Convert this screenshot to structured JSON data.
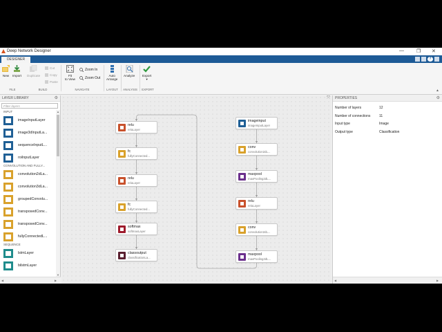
{
  "window": {
    "title": "Deep Network Designer",
    "minimize": "—",
    "maximize": "❐",
    "close": "✕"
  },
  "tabs": [
    {
      "label": "DESIGNER"
    }
  ],
  "toolstrip": {
    "file": {
      "new": "New",
      "import": "Import",
      "section": "FILE"
    },
    "build": {
      "duplicate": "Duplicate",
      "cut": "Cut",
      "copy": "Copy",
      "paste": "Paste",
      "section": "BUILD"
    },
    "navigate": {
      "fit_line1": "Fit",
      "fit_line2": "to View",
      "zoom_in": "Zoom In",
      "zoom_out": "Zoom Out",
      "section": "NAVIGATE"
    },
    "layout": {
      "auto_line1": "Auto",
      "auto_line2": "Arrange",
      "section": "LAYOUT"
    },
    "analysis": {
      "analyze": "Analyze",
      "section": "ANALYSIS"
    },
    "export": {
      "export": "Export",
      "section": "EXPORT"
    }
  },
  "library": {
    "title": "LAYER LIBRARY",
    "filter_placeholder": "Filter layers",
    "categories": [
      {
        "name": "INPUT",
        "items": [
          {
            "label": "imageInputLayer",
            "icon": "image-input-icon"
          },
          {
            "label": "image3dInputLa...",
            "icon": "image3d-input-icon"
          },
          {
            "label": "sequenceInputL...",
            "icon": "sequence-input-icon"
          },
          {
            "label": "roiInputLayer",
            "icon": "roi-input-icon"
          }
        ]
      },
      {
        "name": "CONVOLUTION AND FULLY...",
        "items": [
          {
            "label": "convolution2dLa...",
            "icon": "conv2d-icon"
          },
          {
            "label": "convolution3dLa...",
            "icon": "conv3d-icon"
          },
          {
            "label": "groupedConvolu...",
            "icon": "grouped-conv-icon"
          },
          {
            "label": "transposedConv...",
            "icon": "transposed-conv-icon"
          },
          {
            "label": "transposedConv...",
            "icon": "transposed-conv3d-icon"
          },
          {
            "label": "fullyConnectedL...",
            "icon": "fully-connected-icon"
          }
        ]
      },
      {
        "name": "SEQUENCE",
        "items": [
          {
            "label": "lstmLayer",
            "icon": "lstm-icon"
          },
          {
            "label": "bilstmLayer",
            "icon": "bilstm-icon"
          }
        ]
      }
    ]
  },
  "colors": {
    "input": "#1f5f95",
    "conv": "#d9a12b",
    "pool": "#6b2f8c",
    "relu": "#c8512c",
    "softmax": "#9e1b2c",
    "output": "#5a2030",
    "lstm": "#1f8c8c",
    "accent": "#1d5a96"
  },
  "network": {
    "nodes": [
      {
        "id": "relu_1",
        "name": "relu",
        "type": "reluLayer",
        "kind": "relu"
      },
      {
        "id": "fc_1",
        "name": "fc",
        "type": "fullyConnected...",
        "kind": "conv"
      },
      {
        "id": "relu_2",
        "name": "relu",
        "type": "reluLayer",
        "kind": "relu"
      },
      {
        "id": "fc_2",
        "name": "fc",
        "type": "fullyConnected...",
        "kind": "conv"
      },
      {
        "id": "softmax",
        "name": "softmax",
        "type": "softmaxLayer",
        "kind": "softmax"
      },
      {
        "id": "classoutput",
        "name": "classoutput",
        "type": "classificationLa...",
        "kind": "output"
      },
      {
        "id": "imageinput",
        "name": "imageinput",
        "type": "imageInputLayer",
        "kind": "input"
      },
      {
        "id": "conv_1",
        "name": "conv",
        "type": "convolution2dL...",
        "kind": "conv"
      },
      {
        "id": "maxpool_1",
        "name": "maxpool",
        "type": "maxPooling2dL...",
        "kind": "pool"
      },
      {
        "id": "relu_3",
        "name": "relu",
        "type": "reluLayer",
        "kind": "relu"
      },
      {
        "id": "conv_2",
        "name": "conv",
        "type": "convolution2dL...",
        "kind": "conv"
      },
      {
        "id": "maxpool_2",
        "name": "maxpool",
        "type": "maxPooling2dL...",
        "kind": "pool"
      }
    ],
    "edges": [
      [
        "imageinput",
        "conv_1"
      ],
      [
        "conv_1",
        "maxpool_1"
      ],
      [
        "maxpool_1",
        "relu_3"
      ],
      [
        "relu_3",
        "conv_2"
      ],
      [
        "conv_2",
        "maxpool_2"
      ],
      [
        "maxpool_2",
        "relu_1"
      ],
      [
        "relu_1",
        "fc_1"
      ],
      [
        "fc_1",
        "relu_2"
      ],
      [
        "relu_2",
        "fc_2"
      ],
      [
        "fc_2",
        "softmax"
      ],
      [
        "softmax",
        "classoutput"
      ]
    ]
  },
  "properties": {
    "title": "PROPERTIES",
    "rows": [
      {
        "label": "Number of layers",
        "value": "12"
      },
      {
        "label": "Number of connections",
        "value": "11"
      },
      {
        "label": "Input type",
        "value": "Image"
      },
      {
        "label": "Output type",
        "value": "Classification"
      }
    ]
  }
}
